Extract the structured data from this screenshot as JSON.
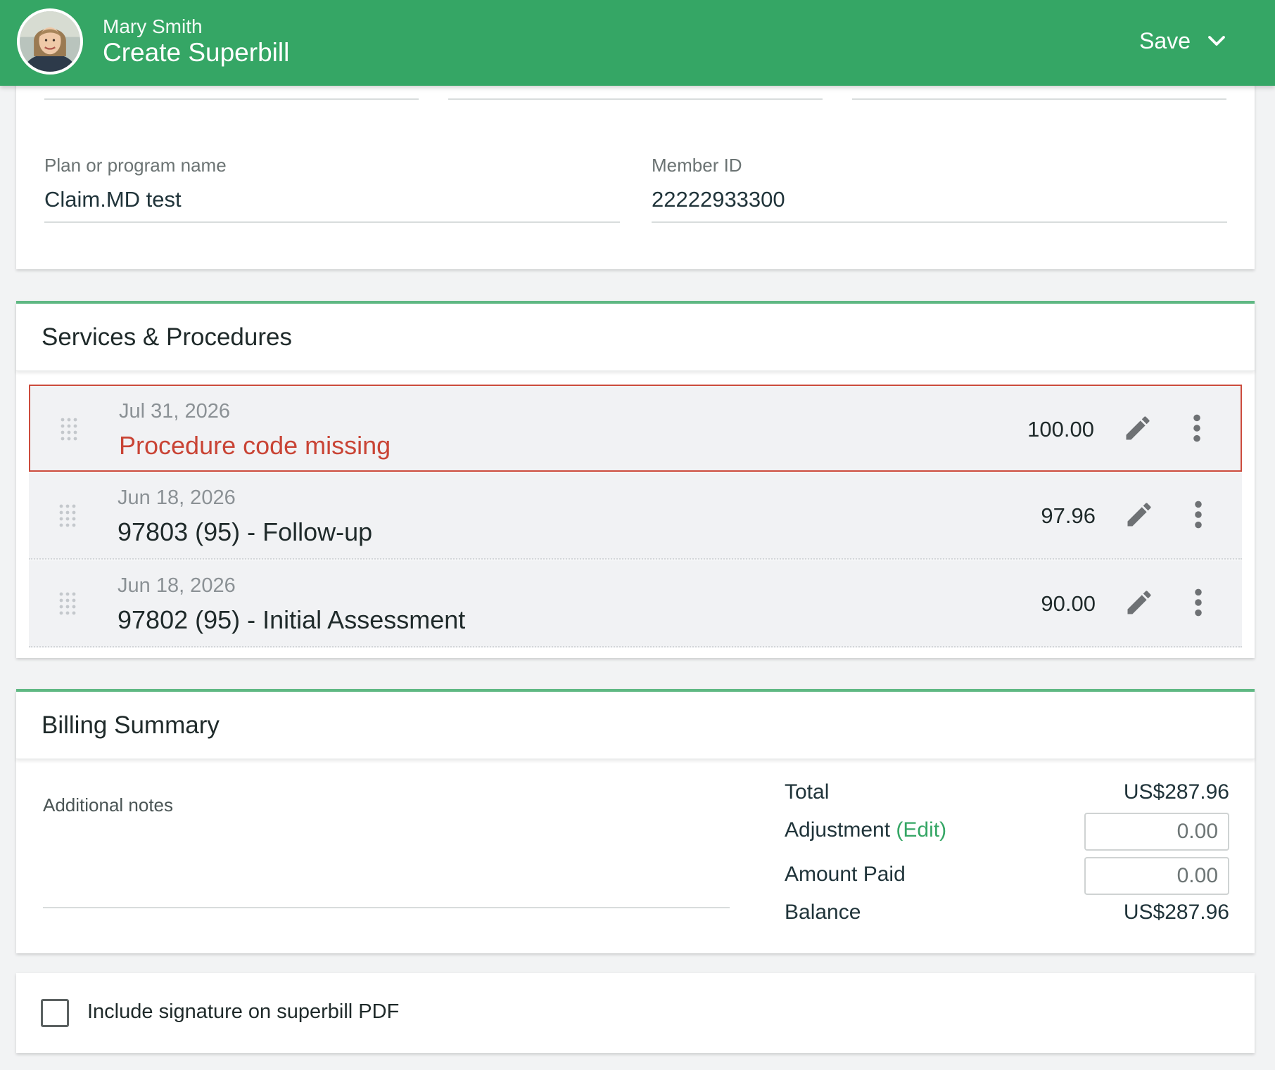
{
  "header": {
    "client_name": "Mary Smith",
    "title": "Create Superbill",
    "save_label": "Save",
    "avatar_icon": "avatar-photo",
    "dropdown_icon": "chevron-down-icon",
    "color": "#35a665"
  },
  "insurance": {
    "plan_label": "Plan or program name",
    "plan_value": "Claim.MD test",
    "member_label": "Member ID",
    "member_value": "22222933300"
  },
  "services": {
    "title": "Services & Procedures",
    "rows": [
      {
        "date": "Jul 31, 2026",
        "description": "Procedure code missing",
        "amount": "100.00",
        "error": true
      },
      {
        "date": "Jun 18, 2026",
        "description": "97803 (95) - Follow-up",
        "amount": "97.96",
        "error": false
      },
      {
        "date": "Jun 18, 2026",
        "description": "97802 (95) - Initial Assessment",
        "amount": "90.00",
        "error": false
      }
    ],
    "error_color": "#c94435",
    "icons": [
      "drag-handle-icon",
      "pencil-icon",
      "more-vertical-icon"
    ]
  },
  "billing": {
    "title": "Billing Summary",
    "notes_label": "Additional notes",
    "total_label": "Total",
    "total_value": "US$287.96",
    "adjustment_label": "Adjustment",
    "adjustment_edit": "(Edit)",
    "adjustment_value": "0.00",
    "paid_label": "Amount Paid",
    "paid_value": "0.00",
    "balance_label": "Balance",
    "balance_value": "US$287.96"
  },
  "signature": {
    "label": "Include signature on superbill PDF",
    "checked": false
  }
}
